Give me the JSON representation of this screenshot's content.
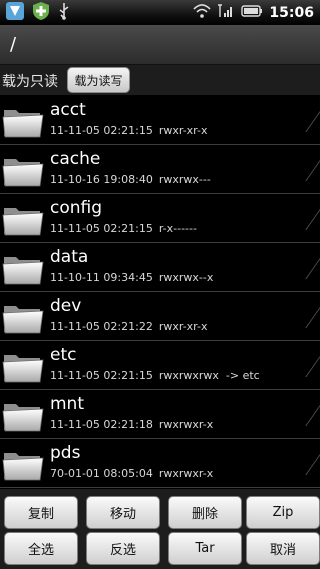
{
  "status_bar": {
    "time": "15:06",
    "icons": [
      "app-icon",
      "shield-plus-icon",
      "usb-icon",
      "wifi-icon",
      "signal-icon",
      "battery-icon"
    ]
  },
  "path": "/",
  "mode": {
    "label": "载为只读",
    "button": "载为读写"
  },
  "files": [
    {
      "name": "acct",
      "date": "11-11-05 02:21:15",
      "perms": "rwxr-xr-x"
    },
    {
      "name": "cache",
      "date": "11-10-16 19:08:40",
      "perms": "rwxrwx---"
    },
    {
      "name": "config",
      "date": "11-11-05 02:21:15",
      "perms": "r-x------"
    },
    {
      "name": "data",
      "date": "11-10-11 09:34:45",
      "perms": "rwxrwx--x"
    },
    {
      "name": "dev",
      "date": "11-11-05 02:21:22",
      "perms": "rwxr-xr-x"
    },
    {
      "name": "etc",
      "date": "11-11-05 02:21:15",
      "perms": "rwxrwxrwx  -> etc"
    },
    {
      "name": "mnt",
      "date": "11-11-05 02:21:18",
      "perms": "rwxrwxr-x"
    },
    {
      "name": "pds",
      "date": "70-01-01 08:05:04",
      "perms": "rwxrwxr-x"
    }
  ],
  "actions": {
    "copy": "复制",
    "move": "移动",
    "delete": "删除",
    "zip": "Zip",
    "select_all": "全选",
    "invert": "反选",
    "tar": "Tar",
    "cancel": "取消"
  },
  "colors": {
    "background": "#000000",
    "button": "#e6e6e6",
    "divider": "#3d3d3d"
  }
}
